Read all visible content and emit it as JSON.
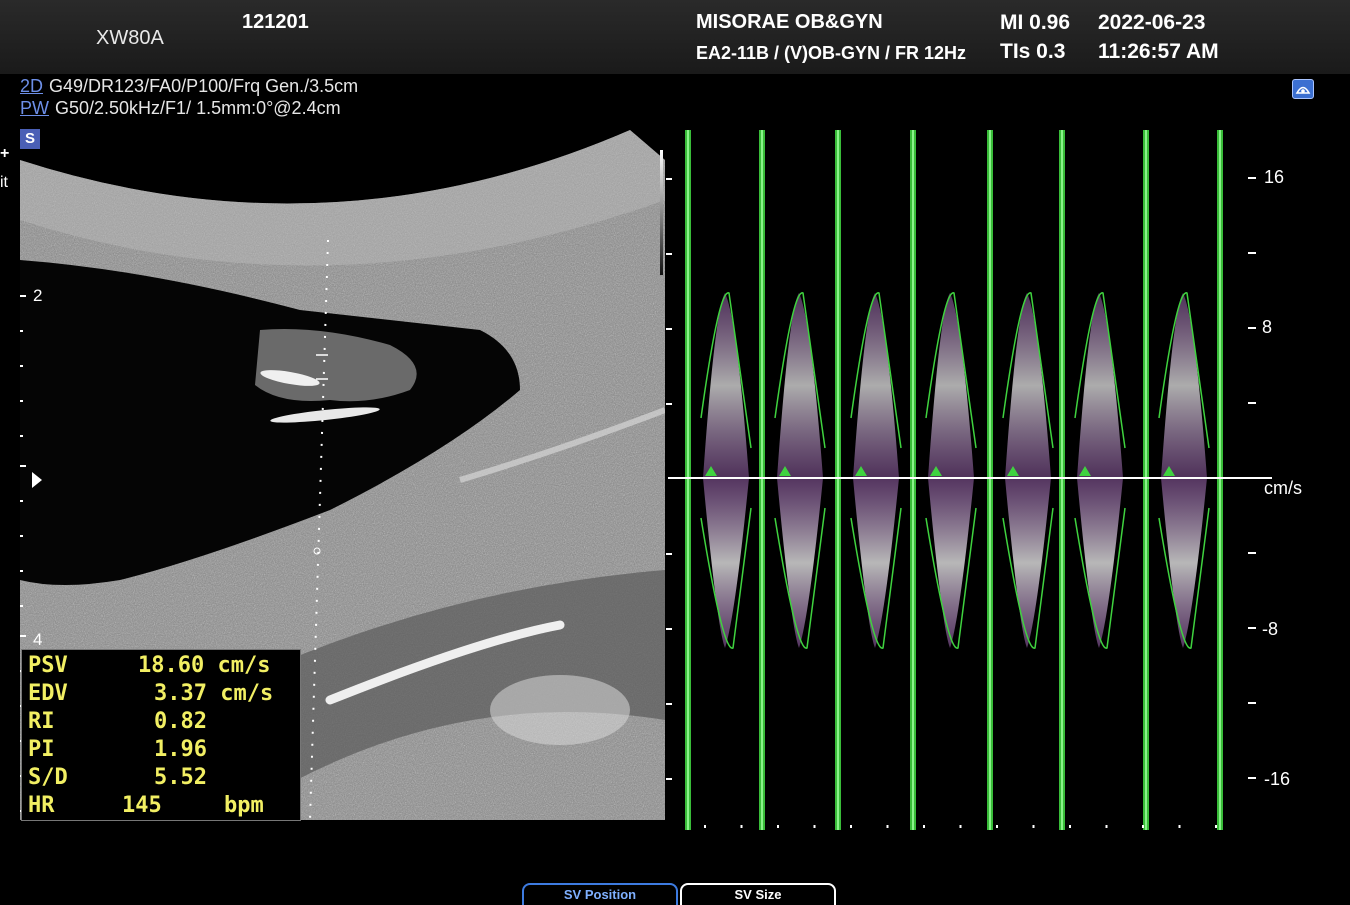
{
  "header": {
    "model": "XW80A",
    "patient_id": "121201",
    "hospital": "MISORAE OB&GYN",
    "probe_preset": "EA2-11B / (V)OB-GYN / FR 12Hz",
    "mi": "MI  0.96",
    "tis": "TIs 0.3",
    "date": "2022-06-23",
    "time": "11:26:57 AM"
  },
  "params": {
    "mode_2d": "2D",
    "settings_2d": "G49/DR123/FA0/P100/Frq Gen./3.5cm",
    "mode_pw": "PW",
    "settings_pw": "G50/2.50kHz/F1/ 1.5mm:0°@2.4cm"
  },
  "badges": {
    "s": "S",
    "plus": "+",
    "it": "it"
  },
  "depth_scale": [
    "2",
    "4"
  ],
  "velocity_scale": {
    "top": "16",
    "upper": "8",
    "unit": "cm/s",
    "lower": "-8",
    "bottom": "-16"
  },
  "measurements": [
    {
      "label": "PSV",
      "value": "18.60 cm/s"
    },
    {
      "label": "EDV",
      "value": "3.37 cm/s"
    },
    {
      "label": "RI",
      "value": "0.82"
    },
    {
      "label": "PI",
      "value": "1.96"
    },
    {
      "label": "S/D",
      "value": "5.52"
    },
    {
      "label": "HR",
      "value": "145",
      "unit": "bpm"
    }
  ],
  "buttons": {
    "sv_position": "SV Position",
    "sv_size": "SV Size"
  },
  "colors": {
    "envelope": "#3fd23f",
    "spectrum": "#c77fd6",
    "measure_text": "#f2ef63",
    "mode_label": "#6d8fe8"
  }
}
